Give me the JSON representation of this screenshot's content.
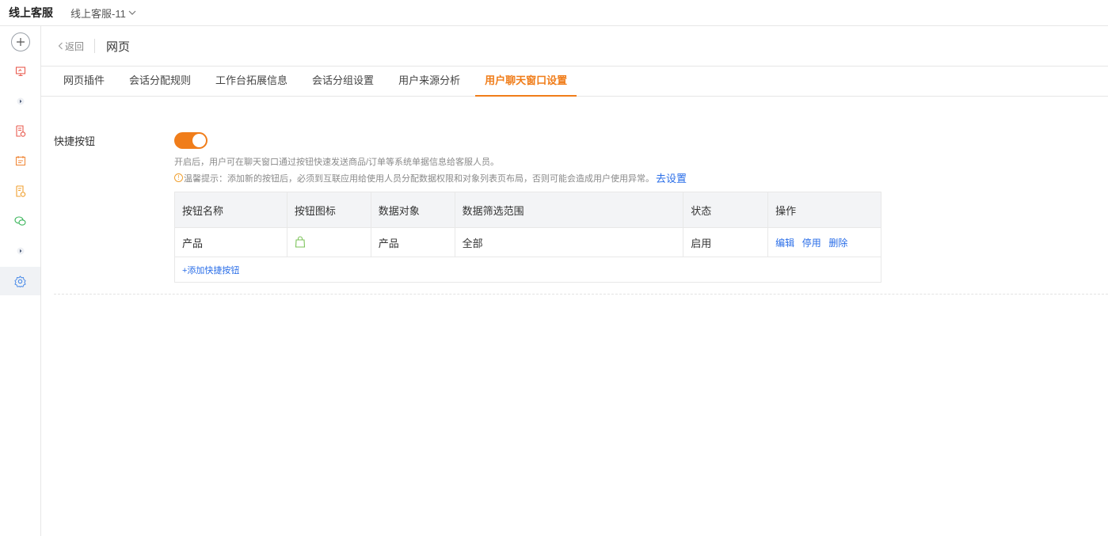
{
  "topbar": {
    "app_title": "线上客服",
    "workspace": "线上客服-11"
  },
  "rail": {
    "icons": [
      "plus-icon",
      "monitor-icon",
      "expand-arrow-icon",
      "report-icon",
      "calendar-icon",
      "document-icon",
      "wechat-icon",
      "expand-arrow-icon",
      "gear-icon"
    ]
  },
  "header": {
    "back_label": "返回",
    "page_title": "网页"
  },
  "tabs": [
    {
      "label": "网页插件"
    },
    {
      "label": "会话分配规则"
    },
    {
      "label": "工作台拓展信息"
    },
    {
      "label": "会话分组设置"
    },
    {
      "label": "用户来源分析"
    },
    {
      "label": "用户聊天窗口设置",
      "active": true
    }
  ],
  "quick_buttons": {
    "label": "快捷按钮",
    "enabled": true,
    "description": "开启后，用户可在聊天窗口通过按钮快速发送商品/订单等系统单据信息给客服人员。",
    "tip_prefix": "温馨提示：添加新的按钮后，必须到互联应用给使用人员分配数据权限和对象列表页布局，否则可能会造成用户使用异常。",
    "tip_link": "去设置",
    "columns": [
      "按钮名称",
      "按钮图标",
      "数据对象",
      "数据筛选范围",
      "状态",
      "操作"
    ],
    "rows": [
      {
        "name": "产品",
        "icon": "shopping-bag-icon",
        "object": "产品",
        "scope": "全部",
        "status": "启用",
        "actions": [
          "编辑",
          "停用",
          "删除"
        ]
      }
    ],
    "add_label": "+添加快捷按钮"
  },
  "colors": {
    "accent": "#f07d1a",
    "link": "#2a6ee8",
    "icon_green": "#7cc35a"
  }
}
